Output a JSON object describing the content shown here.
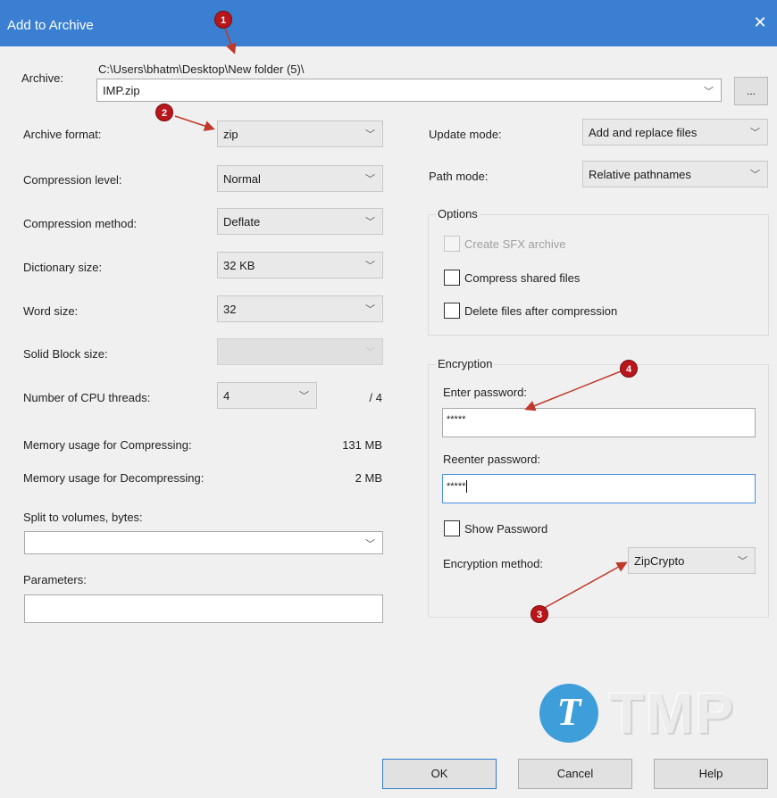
{
  "window": {
    "title": "Add to Archive"
  },
  "archive": {
    "label": "Archive:",
    "path": "C:\\Users\\bhatm\\Desktop\\New folder (5)\\",
    "filename": "IMP.zip",
    "browse_label": "..."
  },
  "left": {
    "archive_format": {
      "label": "Archive format:",
      "value": "zip"
    },
    "compression_level": {
      "label": "Compression level:",
      "value": "Normal"
    },
    "compression_method": {
      "label": "Compression method:",
      "value": "Deflate"
    },
    "dictionary_size": {
      "label": "Dictionary size:",
      "value": "32 KB"
    },
    "word_size": {
      "label": "Word size:",
      "value": "32"
    },
    "solid_block_size": {
      "label": "Solid Block size:",
      "value": ""
    },
    "cpu_threads": {
      "label": "Number of CPU threads:",
      "value": "4",
      "max": "/ 4"
    },
    "memory_compress": {
      "label": "Memory usage for Compressing:",
      "value": "131 MB"
    },
    "memory_decompress": {
      "label": "Memory usage for Decompressing:",
      "value": "2 MB"
    },
    "split_volumes": {
      "label": "Split to volumes, bytes:",
      "value": ""
    },
    "parameters": {
      "label": "Parameters:",
      "value": ""
    }
  },
  "right": {
    "update_mode": {
      "label": "Update mode:",
      "value": "Add and replace files"
    },
    "path_mode": {
      "label": "Path mode:",
      "value": "Relative pathnames"
    },
    "options": {
      "title": "Options",
      "create_sfx": "Create SFX archive",
      "compress_shared": "Compress shared files",
      "delete_after": "Delete files after compression"
    },
    "encryption": {
      "title": "Encryption",
      "enter_password_label": "Enter password:",
      "enter_password_value": "*****",
      "reenter_password_label": "Reenter password:",
      "reenter_password_value": "*****",
      "show_password": "Show Password",
      "method_label": "Encryption method:",
      "method_value": "ZipCrypto"
    }
  },
  "buttons": {
    "ok": "OK",
    "cancel": "Cancel",
    "help": "Help"
  },
  "annotations": {
    "m1": "1",
    "m2": "2",
    "m3": "3",
    "m4": "4"
  },
  "watermark": {
    "text": "TMP",
    "icon_letter": "T"
  },
  "colors": {
    "titlebar": "#3a7fd1",
    "marker": "#b8161b",
    "focus": "#4a90e2"
  }
}
